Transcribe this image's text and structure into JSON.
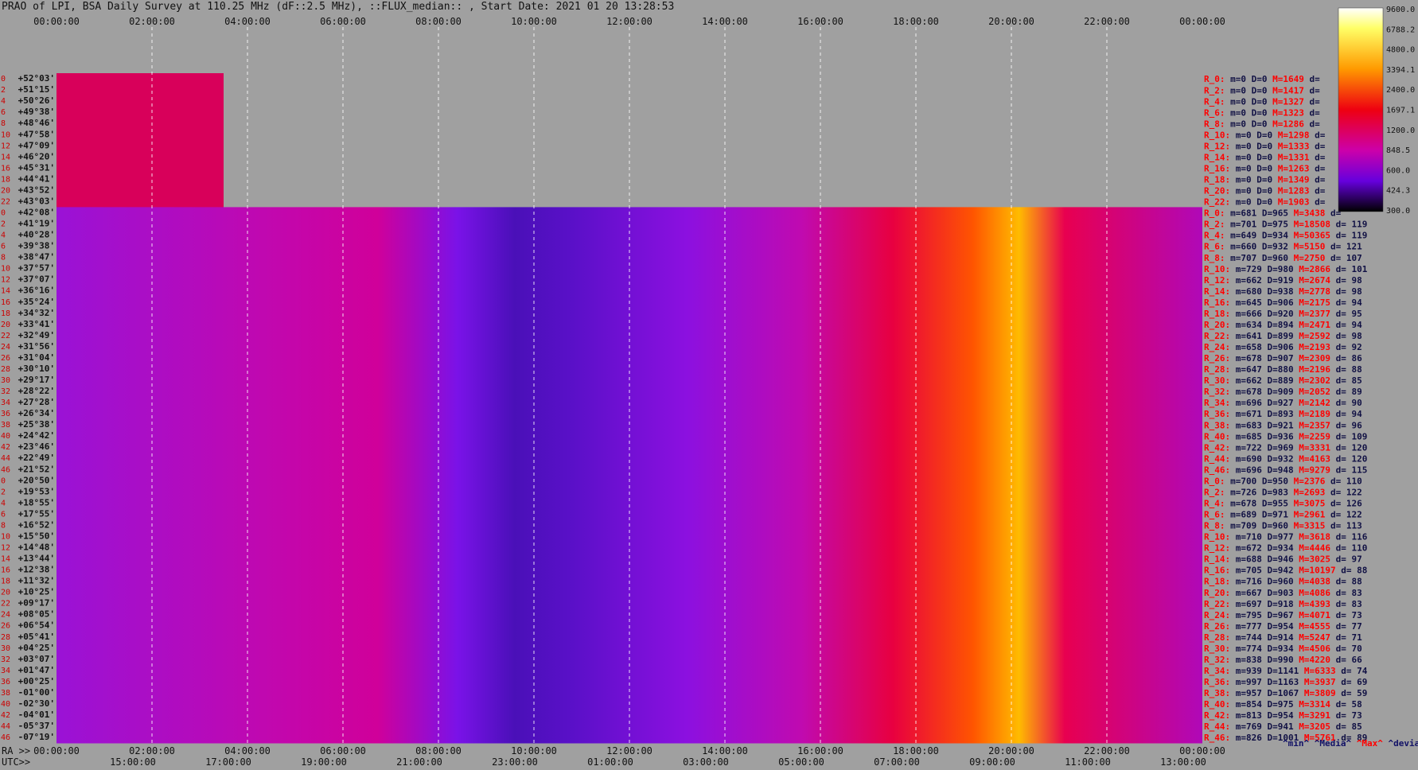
{
  "title": "PRAO of LPI, BSA Daily Survey at 110.25 MHz (dF::2.5 MHz), ::FLUX_median:: , Start Date: 2021 01 20 13:28:53",
  "colors": {
    "background": "#a0a0a0",
    "text": "#111111",
    "row_index": "#cc0000",
    "stat_label": "#ff0000",
    "stat_value": "#111144",
    "stat_max": "#ff0000",
    "grid": "#ffffff"
  },
  "footer": {
    "ra_label": "RA >>",
    "utc_label": "UTC>>",
    "stats_legend": [
      "^min^",
      "^Media^",
      "^Max^",
      "^devia^"
    ]
  },
  "chart_data": {
    "type": "heatmap",
    "title": "PRAO of LPI, BSA Daily Survey at 110.25 MHz (dF::2.5 MHz), ::FLUX_median:: , Start Date: 2021 01 20 13:28:53",
    "x_top_ticks": [
      "00:00:00",
      "02:00:00",
      "04:00:00",
      "06:00:00",
      "08:00:00",
      "10:00:00",
      "12:00:00",
      "14:00:00",
      "16:00:00",
      "18:00:00",
      "20:00:00",
      "22:00:00",
      "00:00:00"
    ],
    "x_ra_ticks": [
      "00:00:00",
      "02:00:00",
      "04:00:00",
      "06:00:00",
      "08:00:00",
      "10:00:00",
      "12:00:00",
      "14:00:00",
      "16:00:00",
      "18:00:00",
      "20:00:00",
      "22:00:00",
      "00:00:00"
    ],
    "x_utc_ticks": [
      "15:00:00",
      "17:00:00",
      "19:00:00",
      "21:00:00",
      "23:00:00",
      "01:00:00",
      "03:00:00",
      "05:00:00",
      "07:00:00",
      "09:00:00",
      "11:00:00",
      "13:00:00"
    ],
    "x_range_hours": [
      0,
      24
    ],
    "grid": true,
    "colorbar": {
      "placement": "top-right",
      "ticks": [
        "9600.0",
        "6788.2",
        "4800.0",
        "3394.1",
        "2400.0",
        "1697.1",
        "1200.0",
        "848.5",
        "600.0",
        "424.3",
        "300.0"
      ],
      "range": [
        300,
        9600
      ],
      "scale": "log"
    },
    "declination_labels": [
      "+52°03'",
      "+51°15'",
      "+50°26'",
      "+49°38'",
      "+48°46'",
      "+47°58'",
      "+47°09'",
      "+46°20'",
      "+45°31'",
      "+44°41'",
      "+43°52'",
      "+43°03'",
      "+42°08'",
      "+41°19'",
      "+40°28'",
      "+39°38'",
      "+38°47'",
      "+37°57'",
      "+37°07'",
      "+36°16'",
      "+35°24'",
      "+34°32'",
      "+33°41'",
      "+32°49'",
      "+31°56'",
      "+31°04'",
      "+30°10'",
      "+29°17'",
      "+28°22'",
      "+27°28'",
      "+26°34'",
      "+25°38'",
      "+24°42'",
      "+23°46'",
      "+22°49'",
      "+21°52'",
      "+20°50'",
      "+19°53'",
      "+18°55'",
      "+17°55'",
      "+16°52'",
      "+15°50'",
      "+14°48'",
      "+13°44'",
      "+12°38'",
      "+11°32'",
      "+10°25'",
      "+09°17'",
      "+08°05'",
      "+06°54'",
      "+05°41'",
      "+04°25'",
      "+03°07'",
      "+01°47'",
      "+00°25'",
      "-01°00'",
      "-02°30'",
      "-04°01'",
      "-05°37'",
      "-07°19'"
    ],
    "row_indices": [
      "0",
      "2",
      "4",
      "6",
      "8",
      "10",
      "12",
      "14",
      "16",
      "18",
      "20",
      "22",
      "0",
      "2",
      "4",
      "6",
      "8",
      "10",
      "12",
      "14",
      "16",
      "18",
      "20",
      "22",
      "24",
      "26",
      "28",
      "30",
      "32",
      "34",
      "36",
      "38",
      "40",
      "42",
      "44",
      "46",
      "0",
      "2",
      "4",
      "6",
      "8",
      "10",
      "12",
      "14",
      "16",
      "18",
      "20",
      "22",
      "24",
      "26",
      "28",
      "30",
      "32",
      "34",
      "36",
      "38",
      "40",
      "42",
      "44",
      "46"
    ],
    "row_stats": [
      {
        "label": "R_0:",
        "min": "0",
        "med": "0",
        "max": "1649",
        "dev": ""
      },
      {
        "label": "R_2:",
        "min": "0",
        "med": "0",
        "max": "1417",
        "dev": ""
      },
      {
        "label": "R_4:",
        "min": "0",
        "med": "0",
        "max": "1327",
        "dev": ""
      },
      {
        "label": "R_6:",
        "min": "0",
        "med": "0",
        "max": "1323",
        "dev": ""
      },
      {
        "label": "R_8:",
        "min": "0",
        "med": "0",
        "max": "1286",
        "dev": ""
      },
      {
        "label": "R_10:",
        "min": "0",
        "med": "0",
        "max": "1298",
        "dev": ""
      },
      {
        "label": "R_12:",
        "min": "0",
        "med": "0",
        "max": "1333",
        "dev": ""
      },
      {
        "label": "R_14:",
        "min": "0",
        "med": "0",
        "max": "1331",
        "dev": ""
      },
      {
        "label": "R_16:",
        "min": "0",
        "med": "0",
        "max": "1263",
        "dev": ""
      },
      {
        "label": "R_18:",
        "min": "0",
        "med": "0",
        "max": "1349",
        "dev": ""
      },
      {
        "label": "R_20:",
        "min": "0",
        "med": "0",
        "max": "1283",
        "dev": ""
      },
      {
        "label": "R_22:",
        "min": "0",
        "med": "0",
        "max": "1903",
        "dev": ""
      },
      {
        "label": "R_0:",
        "min": "681",
        "med": "965",
        "max": "3438",
        "dev": ""
      },
      {
        "label": "R_2:",
        "min": "701",
        "med": "975",
        "max": "18508",
        "dev": "119"
      },
      {
        "label": "R_4:",
        "min": "649",
        "med": "934",
        "max": "50365",
        "dev": "119"
      },
      {
        "label": "R_6:",
        "min": "660",
        "med": "932",
        "max": "5150",
        "dev": "121"
      },
      {
        "label": "R_8:",
        "min": "707",
        "med": "960",
        "max": "2750",
        "dev": "107"
      },
      {
        "label": "R_10:",
        "min": "729",
        "med": "980",
        "max": "2866",
        "dev": "101"
      },
      {
        "label": "R_12:",
        "min": "662",
        "med": "919",
        "max": "2674",
        "dev": "98"
      },
      {
        "label": "R_14:",
        "min": "680",
        "med": "938",
        "max": "2778",
        "dev": "98"
      },
      {
        "label": "R_16:",
        "min": "645",
        "med": "906",
        "max": "2175",
        "dev": "94"
      },
      {
        "label": "R_18:",
        "min": "666",
        "med": "920",
        "max": "2377",
        "dev": "95"
      },
      {
        "label": "R_20:",
        "min": "634",
        "med": "894",
        "max": "2471",
        "dev": "94"
      },
      {
        "label": "R_22:",
        "min": "641",
        "med": "899",
        "max": "2592",
        "dev": "98"
      },
      {
        "label": "R_24:",
        "min": "658",
        "med": "906",
        "max": "2193",
        "dev": "92"
      },
      {
        "label": "R_26:",
        "min": "678",
        "med": "907",
        "max": "2309",
        "dev": "86"
      },
      {
        "label": "R_28:",
        "min": "647",
        "med": "880",
        "max": "2196",
        "dev": "88"
      },
      {
        "label": "R_30:",
        "min": "662",
        "med": "889",
        "max": "2302",
        "dev": "85"
      },
      {
        "label": "R_32:",
        "min": "678",
        "med": "909",
        "max": "2052",
        "dev": "89"
      },
      {
        "label": "R_34:",
        "min": "696",
        "med": "927",
        "max": "2142",
        "dev": "90"
      },
      {
        "label": "R_36:",
        "min": "671",
        "med": "893",
        "max": "2189",
        "dev": "94"
      },
      {
        "label": "R_38:",
        "min": "683",
        "med": "921",
        "max": "2357",
        "dev": "96"
      },
      {
        "label": "R_40:",
        "min": "685",
        "med": "936",
        "max": "2259",
        "dev": "109"
      },
      {
        "label": "R_42:",
        "min": "722",
        "med": "969",
        "max": "3331",
        "dev": "120"
      },
      {
        "label": "R_44:",
        "min": "690",
        "med": "932",
        "max": "4163",
        "dev": "120"
      },
      {
        "label": "R_46:",
        "min": "696",
        "med": "948",
        "max": "9279",
        "dev": "115"
      },
      {
        "label": "R_0:",
        "min": "700",
        "med": "950",
        "max": "2376",
        "dev": "110"
      },
      {
        "label": "R_2:",
        "min": "726",
        "med": "983",
        "max": "2693",
        "dev": "122"
      },
      {
        "label": "R_4:",
        "min": "678",
        "med": "955",
        "max": "3075",
        "dev": "126"
      },
      {
        "label": "R_6:",
        "min": "689",
        "med": "971",
        "max": "2961",
        "dev": "122"
      },
      {
        "label": "R_8:",
        "min": "709",
        "med": "960",
        "max": "3315",
        "dev": "113"
      },
      {
        "label": "R_10:",
        "min": "710",
        "med": "977",
        "max": "3618",
        "dev": "116"
      },
      {
        "label": "R_12:",
        "min": "672",
        "med": "934",
        "max": "4446",
        "dev": "110"
      },
      {
        "label": "R_14:",
        "min": "688",
        "med": "946",
        "max": "3025",
        "dev": "97"
      },
      {
        "label": "R_16:",
        "min": "705",
        "med": "942",
        "max": "10197",
        "dev": "88"
      },
      {
        "label": "R_18:",
        "min": "716",
        "med": "960",
        "max": "4038",
        "dev": "88"
      },
      {
        "label": "R_20:",
        "min": "667",
        "med": "903",
        "max": "4086",
        "dev": "83"
      },
      {
        "label": "R_22:",
        "min": "697",
        "med": "918",
        "max": "4393",
        "dev": "83"
      },
      {
        "label": "R_24:",
        "min": "795",
        "med": "967",
        "max": "4071",
        "dev": "73"
      },
      {
        "label": "R_26:",
        "min": "777",
        "med": "954",
        "max": "4555",
        "dev": "77"
      },
      {
        "label": "R_28:",
        "min": "744",
        "med": "914",
        "max": "5247",
        "dev": "71"
      },
      {
        "label": "R_30:",
        "min": "774",
        "med": "934",
        "max": "4506",
        "dev": "70"
      },
      {
        "label": "R_32:",
        "min": "838",
        "med": "990",
        "max": "4220",
        "dev": "66"
      },
      {
        "label": "R_34:",
        "min": "939",
        "med": "1141",
        "max": "6333",
        "dev": "74"
      },
      {
        "label": "R_36:",
        "min": "997",
        "med": "1163",
        "max": "3937",
        "dev": "69"
      },
      {
        "label": "R_38:",
        "min": "957",
        "med": "1067",
        "max": "3809",
        "dev": "59"
      },
      {
        "label": "R_40:",
        "min": "854",
        "med": "975",
        "max": "3314",
        "dev": "58"
      },
      {
        "label": "R_42:",
        "min": "813",
        "med": "954",
        "max": "3291",
        "dev": "73"
      },
      {
        "label": "R_44:",
        "min": "769",
        "med": "941",
        "max": "3205",
        "dev": "85"
      },
      {
        "label": "R_46:",
        "min": "826",
        "med": "1001",
        "max": "5761",
        "dev": "89"
      }
    ]
  }
}
